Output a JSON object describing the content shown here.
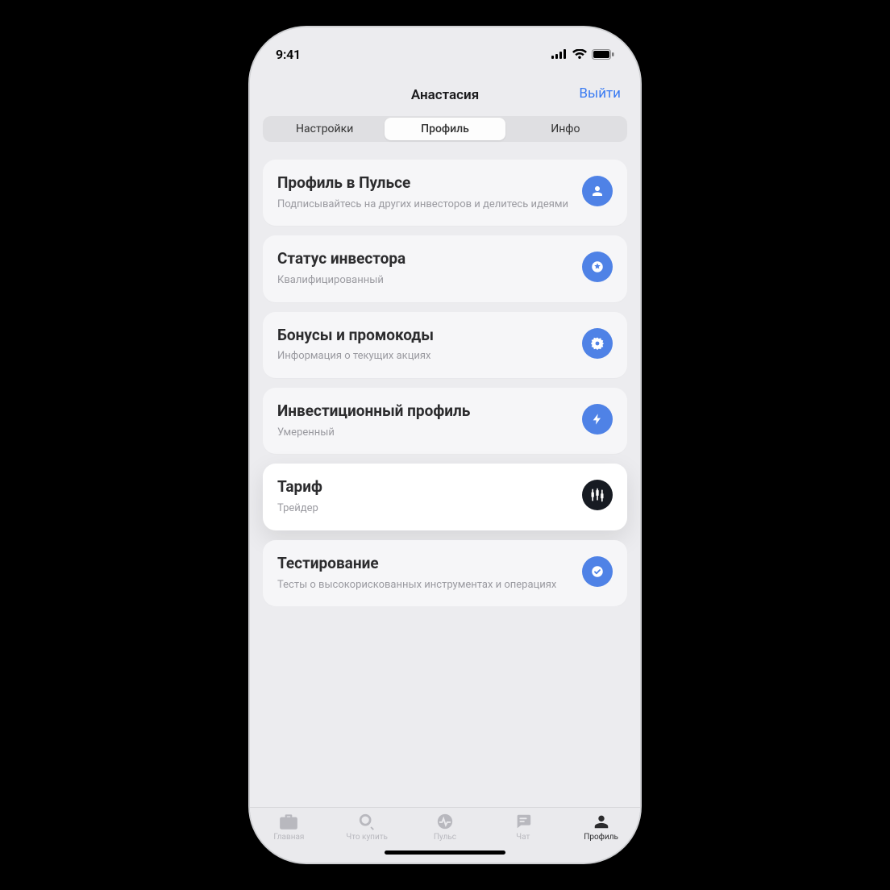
{
  "status": {
    "time": "9:41"
  },
  "header": {
    "title": "Анастасия",
    "action": "Выйти"
  },
  "segmented": {
    "items": [
      {
        "label": "Настройки"
      },
      {
        "label": "Профиль"
      },
      {
        "label": "Инфо"
      }
    ],
    "active_index": 1
  },
  "cards": [
    {
      "title": "Профиль в Пульсе",
      "subtitle": "Подписывайтесь на других инвесторов и делитесь идеями",
      "icon": "person",
      "highlight": false,
      "badge_color": "#4f82e6"
    },
    {
      "title": "Статус инвестора",
      "subtitle": "Квалифицированный",
      "icon": "badge-star",
      "highlight": false,
      "badge_color": "#4f82e6"
    },
    {
      "title": "Бонусы и промокоды",
      "subtitle": "Информация о текущих акциях",
      "icon": "gear-star",
      "highlight": false,
      "badge_color": "#4f82e6"
    },
    {
      "title": "Инвестиционный профиль",
      "subtitle": "Умеренный",
      "icon": "bolt",
      "highlight": false,
      "badge_color": "#4f82e6"
    },
    {
      "title": "Тариф",
      "subtitle": "Трейдер",
      "icon": "candles",
      "highlight": true,
      "badge_color": "#171b22"
    },
    {
      "title": "Тестирование",
      "subtitle": "Тесты о высокорискованных инструментах и операциях",
      "icon": "check-circle",
      "highlight": false,
      "badge_color": "#4f82e6"
    }
  ],
  "tabbar": {
    "items": [
      {
        "label": "Главная",
        "icon": "briefcase"
      },
      {
        "label": "Что купить",
        "icon": "search"
      },
      {
        "label": "Пульс",
        "icon": "pulse"
      },
      {
        "label": "Чат",
        "icon": "chat"
      },
      {
        "label": "Профиль",
        "icon": "person"
      }
    ],
    "active_index": 4
  },
  "colors": {
    "accent": "#3a7bf2",
    "badge_blue": "#4f82e6",
    "badge_dark": "#171b22",
    "bg": "#ececef",
    "card": "#f6f6f8"
  }
}
